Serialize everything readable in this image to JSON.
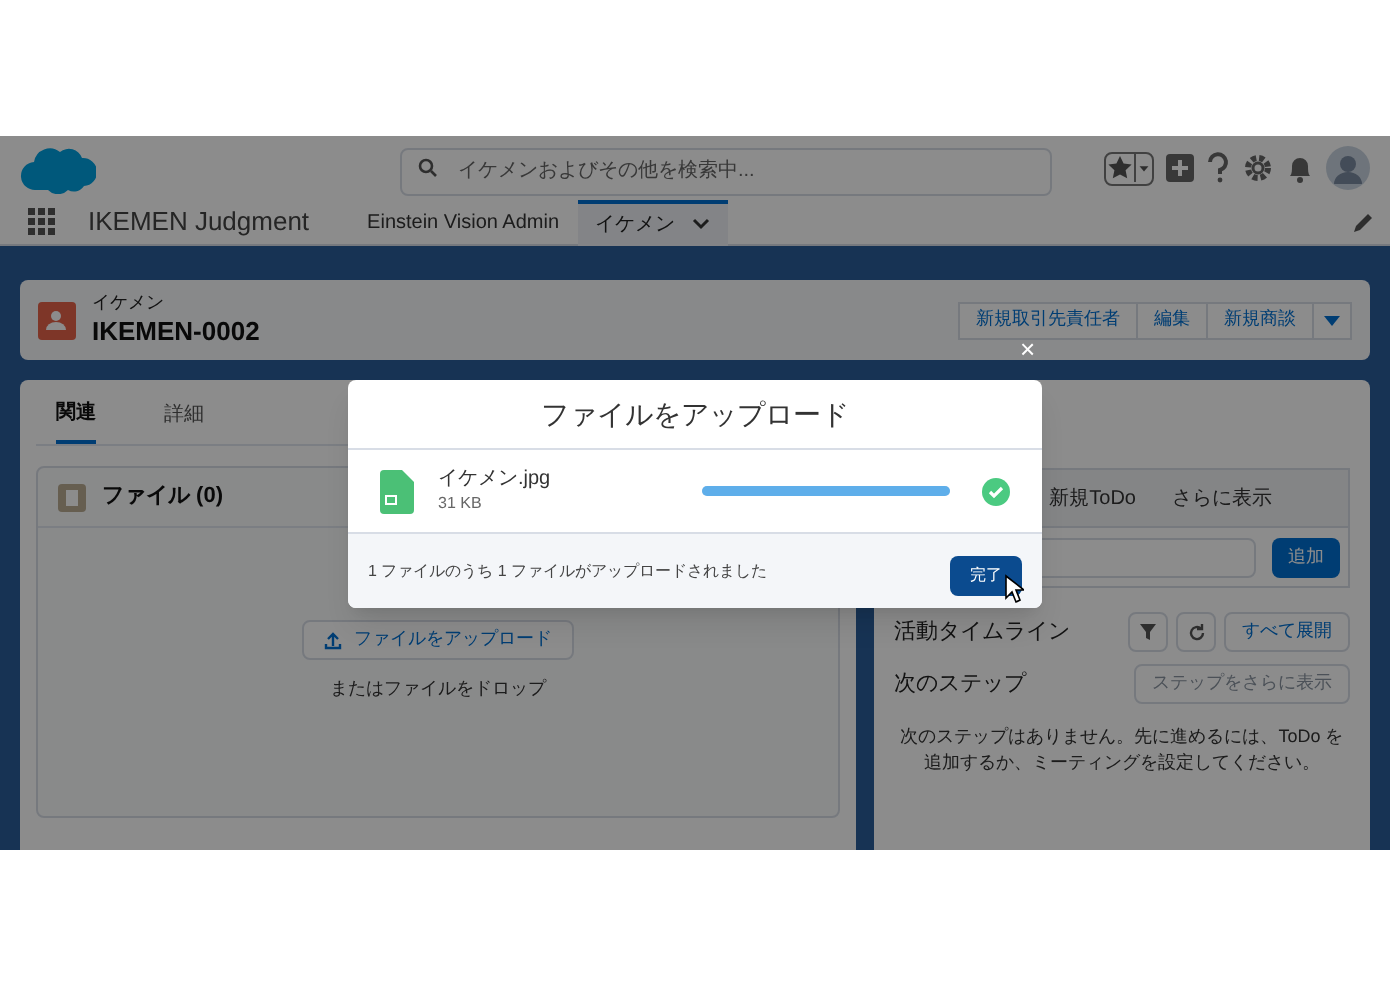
{
  "header": {
    "search": {
      "placeholder": "イケメンおよびその他を検索中..."
    }
  },
  "nav": {
    "app_name": "IKEMEN Judgment",
    "tabs": [
      {
        "label": "Einstein Vision Admin",
        "selected": false
      },
      {
        "label": "イケメン",
        "selected": true
      }
    ]
  },
  "record": {
    "object_label": "イケメン",
    "name": "IKEMEN-0002",
    "actions": [
      "新規取引先責任者",
      "編集",
      "新規商談"
    ]
  },
  "left_panel": {
    "tabs": [
      {
        "label": "関連",
        "selected": true
      },
      {
        "label": "詳細",
        "selected": false
      }
    ],
    "files_card": {
      "title": "ファイル (0)",
      "upload_button": "ファイルをアップロード",
      "drop_hint": "またはファイルをドロップ"
    }
  },
  "right_panel": {
    "publisher_tabs": [
      "新規ToDo",
      "さらに表示"
    ],
    "add_button": "追加",
    "timeline_title": "活動タイムライン",
    "expand_all": "すべて展開",
    "next_steps_title": "次のステップ",
    "more_steps_button": {
      "label": "ステップをさらに表示",
      "disabled": true
    },
    "next_steps_message": "次のステップはありません。先に進めるには、ToDo を追加するか、ミーティングを設定してください。"
  },
  "dialog": {
    "close": "×",
    "title": "ファイルをアップロード",
    "files": [
      {
        "name": "イケメン.jpg",
        "size": "31 KB",
        "level": 1,
        "done": true
      }
    ],
    "summary": "1 ファイルのうち 1 ファイルがアップロードされました",
    "done_button": "完了"
  }
}
